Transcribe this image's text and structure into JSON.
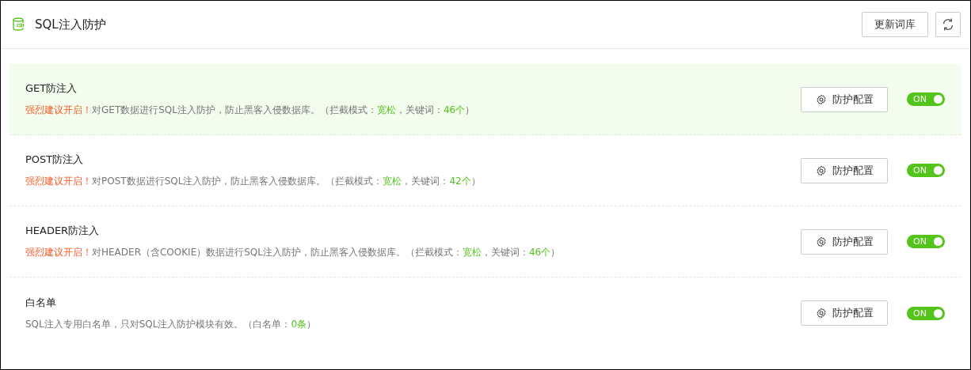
{
  "header": {
    "title": "SQL注入防护",
    "buttons": [
      {
        "label": "更新词库"
      }
    ]
  },
  "rules": [
    {
      "name": "GET防注入",
      "selected": true,
      "description": [
        {
          "kind": "warning",
          "text": "强烈建议开启！"
        },
        {
          "kind": "plain",
          "text": "对GET数据进行SQL注入防护，防止黑客入侵数据库。（拦截模式："
        },
        {
          "kind": "value",
          "text": "宽松"
        },
        {
          "kind": "plain",
          "text": "，关键词："
        },
        {
          "kind": "value",
          "text": "46个"
        },
        {
          "kind": "plain",
          "text": "）"
        }
      ],
      "config_label": "防护配置",
      "toggle": {
        "on": true,
        "label": "ON"
      }
    },
    {
      "name": "POST防注入",
      "selected": false,
      "description": [
        {
          "kind": "warning",
          "text": "强烈建议开启！"
        },
        {
          "kind": "plain",
          "text": "对POST数据进行SQL注入防护，防止黑客入侵数据库。（拦截模式："
        },
        {
          "kind": "value",
          "text": "宽松"
        },
        {
          "kind": "plain",
          "text": "，关键词："
        },
        {
          "kind": "value",
          "text": "42个"
        },
        {
          "kind": "plain",
          "text": "）"
        }
      ],
      "config_label": "防护配置",
      "toggle": {
        "on": true,
        "label": "ON"
      }
    },
    {
      "name": "HEADER防注入",
      "selected": false,
      "description": [
        {
          "kind": "warning",
          "text": "强烈建议开启！"
        },
        {
          "kind": "plain",
          "text": "对HEADER（含COOKIE）数据进行SQL注入防护，防止黑客入侵数据库。（拦截模式："
        },
        {
          "kind": "value",
          "text": "宽松"
        },
        {
          "kind": "plain",
          "text": "，关键词："
        },
        {
          "kind": "value",
          "text": "46个"
        },
        {
          "kind": "plain",
          "text": "）"
        }
      ],
      "config_label": "防护配置",
      "toggle": {
        "on": true,
        "label": "ON"
      }
    },
    {
      "name": "白名单",
      "selected": false,
      "description": [
        {
          "kind": "plain",
          "text": "SQL注入专用白名单，只对SQL注入防护模块有效。（白名单："
        },
        {
          "kind": "value",
          "text": "0条"
        },
        {
          "kind": "plain",
          "text": "）"
        }
      ],
      "config_label": "防护配置",
      "toggle": {
        "on": true,
        "label": "ON"
      }
    }
  ]
}
